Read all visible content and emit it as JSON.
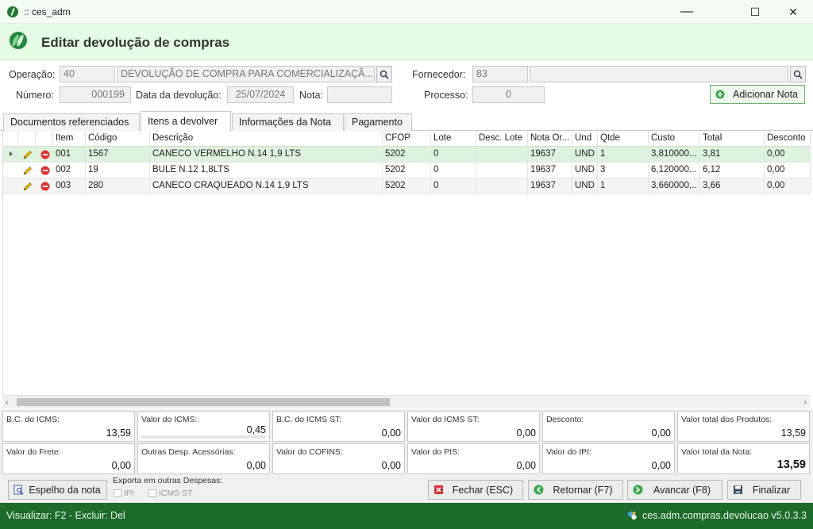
{
  "window": {
    "title": ":: ces_adm",
    "minimize": "—",
    "maximize": "☐",
    "close": "✕"
  },
  "header": {
    "title": "Editar devolução de compras"
  },
  "form": {
    "operacao_label": "Operação:",
    "operacao_code": "40",
    "operacao_desc": "DEVOLUÇÃO DE COMPRA PARA COMERCIALIZAÇÃ...",
    "fornecedor_label": "Fornecedor:",
    "fornecedor_code": "83",
    "fornecedor_name": "",
    "numero_label": "Número:",
    "numero_value": "000199",
    "data_label": "Data da devolução:",
    "data_value": "25/07/2024",
    "nota_label": "Nota:",
    "nota_value": "",
    "processo_label": "Processo:",
    "processo_value": "0",
    "add_nota_label": "Adicionar Nota"
  },
  "tabs": [
    {
      "label": "Documentos referenciados"
    },
    {
      "label": "Itens a devolver"
    },
    {
      "label": "Informações da Nota"
    },
    {
      "label": "Pagamento"
    }
  ],
  "grid": {
    "columns": [
      "Item",
      "Código",
      "Descrição",
      "CFOP",
      "Lote",
      "Desc. Lote",
      "Nota Or...",
      "Und",
      "Qtde",
      "Custo",
      "Total",
      "Desconto"
    ],
    "rows": [
      {
        "item": "001",
        "codigo": "1567",
        "descricao": "CANECO VERMELHO N.14 1,9 LTS",
        "cfop": "5202",
        "lote": "0",
        "desc_lote": "",
        "nota_or": "19637",
        "und": "UND",
        "qtde": "1",
        "custo": "3,810000...",
        "total": "3,81",
        "desconto": "0,00"
      },
      {
        "item": "002",
        "codigo": "19",
        "descricao": "BULE N.12 1,8LTS",
        "cfop": "5202",
        "lote": "0",
        "desc_lote": "",
        "nota_or": "19637",
        "und": "UND",
        "qtde": "3",
        "custo": "6,120000...",
        "total": "6,12",
        "desconto": "0,00"
      },
      {
        "item": "003",
        "codigo": "280",
        "descricao": "CANECO CRAQUEADO N.14 1,9 LTS",
        "cfop": "5202",
        "lote": "0",
        "desc_lote": "",
        "nota_or": "19637",
        "und": "UND",
        "qtde": "1",
        "custo": "3,660000...",
        "total": "3,66",
        "desconto": "0,00"
      }
    ]
  },
  "totals": {
    "bc_icms": {
      "label": "B.C. do ICMS:",
      "value": "13,59"
    },
    "valor_icms": {
      "label": "Valor do ICMS:",
      "value": "0,45"
    },
    "bc_icms_st": {
      "label": "B.C. do ICMS ST:",
      "value": "0,00"
    },
    "valor_icms_st": {
      "label": "Valor do ICMS ST:",
      "value": "0,00"
    },
    "desconto": {
      "label": "Desconto:",
      "value": "0,00"
    },
    "valor_produtos": {
      "label": "Valor total dos Produtos:",
      "value": "13,59"
    },
    "valor_frete": {
      "label": "Valor do Frete:",
      "value": "0,00"
    },
    "outras_desp": {
      "label": "Outras Desp. Acessórias:",
      "value": "0,00"
    },
    "valor_cofins": {
      "label": "Valor do COFINS:",
      "value": "0,00"
    },
    "valor_pis": {
      "label": "Valor do PIS:",
      "value": "0,00"
    },
    "valor_ipi": {
      "label": "Valor do IPI:",
      "value": "0,00"
    },
    "valor_nota": {
      "label": "Valor total da Nota:",
      "value": "13,59"
    }
  },
  "actions": {
    "espelho_label": "Espelho da nota",
    "exporta_label": "Exporta em outras Despesas:",
    "ipi_label": "IPI",
    "icms_st_label": "ICMS ST",
    "fechar_label": "Fechar (ESC)",
    "retornar_label": "Retornar (F7)",
    "avancar_label": "Avancar (F8)",
    "finalizar_label": "Finalizar"
  },
  "status": {
    "shortcuts": "Visualizar: F2 - Excluir: Del",
    "version": "ces.adm.compras.devolucao v5.0.3.3"
  },
  "colors": {
    "accent": "#1d6b2a",
    "header_bg": "#e6fbe4",
    "selected_row": "#ddf3dd"
  }
}
